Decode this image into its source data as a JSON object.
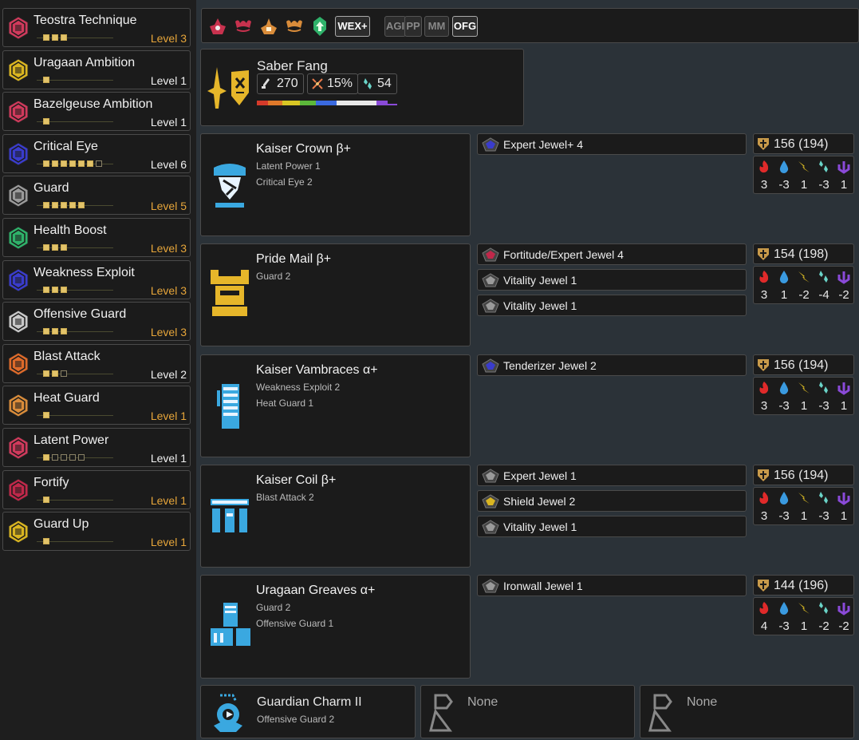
{
  "skills": [
    {
      "name": "Teostra Technique",
      "level": "Level 3",
      "color": "#d03a5c",
      "max": 3,
      "filled": 3,
      "level_color": "#e6a53a"
    },
    {
      "name": "Uragaan Ambition",
      "level": "Level 1",
      "color": "#d9b521",
      "max": 1,
      "filled": 1,
      "level_color": "#f0f0f0"
    },
    {
      "name": "Bazelgeuse Ambition",
      "level": "Level 1",
      "color": "#d03a5c",
      "max": 1,
      "filled": 1,
      "level_color": "#f0f0f0"
    },
    {
      "name": "Critical Eye",
      "level": "Level 6",
      "color": "#3a3ccc",
      "max": 7,
      "filled": 6,
      "level_color": "#f0f0f0"
    },
    {
      "name": "Guard",
      "level": "Level 5",
      "color": "#9a9a9a",
      "max": 5,
      "filled": 5,
      "level_color": "#e6a53a"
    },
    {
      "name": "Health Boost",
      "level": "Level 3",
      "color": "#2fb26a",
      "max": 3,
      "filled": 3,
      "level_color": "#e6a53a"
    },
    {
      "name": "Weakness Exploit",
      "level": "Level 3",
      "color": "#3a3ccc",
      "max": 3,
      "filled": 3,
      "level_color": "#e6a53a"
    },
    {
      "name": "Offensive Guard",
      "level": "Level 3",
      "color": "#c9c9c9",
      "max": 3,
      "filled": 3,
      "level_color": "#e6a53a"
    },
    {
      "name": "Blast Attack",
      "level": "Level 2",
      "color": "#dd6a2a",
      "max": 3,
      "filled": 2,
      "level_color": "#f0f0f0"
    },
    {
      "name": "Heat Guard",
      "level": "Level 1",
      "color": "#d98c3a",
      "max": 1,
      "filled": 1,
      "level_color": "#e6a53a"
    },
    {
      "name": "Latent Power",
      "level": "Level 1",
      "color": "#d03a5c",
      "max": 5,
      "filled": 1,
      "level_color": "#f0f0f0"
    },
    {
      "name": "Fortify",
      "level": "Level 1",
      "color": "#c0284a",
      "max": 1,
      "filled": 1,
      "level_color": "#e6a53a"
    },
    {
      "name": "Guard Up",
      "level": "Level 1",
      "color": "#d9b521",
      "max": 1,
      "filled": 1,
      "level_color": "#e6a53a"
    }
  ],
  "topbar": {
    "tags": [
      {
        "label": "WEX+",
        "active": true
      },
      {
        "label": "AGI",
        "active": false
      },
      {
        "label": "PP",
        "active": false
      },
      {
        "label": "MM",
        "active": false
      },
      {
        "label": "OFG",
        "active": true
      }
    ]
  },
  "weapon": {
    "name": "Saber Fang",
    "attack": "270",
    "affinity": "15%",
    "element": "54"
  },
  "armor": [
    {
      "name": "Kaiser Crown β+",
      "skills": [
        "Latent Power 1",
        "Critical Eye 2"
      ],
      "decos": [
        "Expert Jewel+ 4"
      ],
      "defense": "156  (194)",
      "res": [
        "3",
        "-3",
        "1",
        "-3",
        "1"
      ]
    },
    {
      "name": "Pride Mail β+",
      "skills": [
        "Guard 2"
      ],
      "decos": [
        "Fortitude/Expert Jewel 4",
        "Vitality Jewel 1",
        "Vitality Jewel 1"
      ],
      "defense": "154  (198)",
      "res": [
        "3",
        "1",
        "-2",
        "-4",
        "-2"
      ]
    },
    {
      "name": "Kaiser Vambraces α+",
      "skills": [
        "Weakness Exploit 2",
        "Heat Guard 1"
      ],
      "decos": [
        "Tenderizer Jewel 2"
      ],
      "defense": "156  (194)",
      "res": [
        "3",
        "-3",
        "1",
        "-3",
        "1"
      ]
    },
    {
      "name": "Kaiser Coil β+",
      "skills": [
        "Blast Attack 2"
      ],
      "decos": [
        "Expert Jewel 1",
        "Shield Jewel 2",
        "Vitality Jewel 1"
      ],
      "defense": "156  (194)",
      "res": [
        "3",
        "-3",
        "1",
        "-3",
        "1"
      ]
    },
    {
      "name": "Uragaan Greaves α+",
      "skills": [
        "Guard 2",
        "Offensive Guard 1"
      ],
      "decos": [
        "Ironwall Jewel 1"
      ],
      "defense": "144  (196)",
      "res": [
        "4",
        "-3",
        "1",
        "-2",
        "-2"
      ]
    }
  ],
  "charm": {
    "name": "Guardian Charm II",
    "skill": "Offensive Guard 2"
  },
  "extra_slots": [
    "None",
    "None"
  ]
}
